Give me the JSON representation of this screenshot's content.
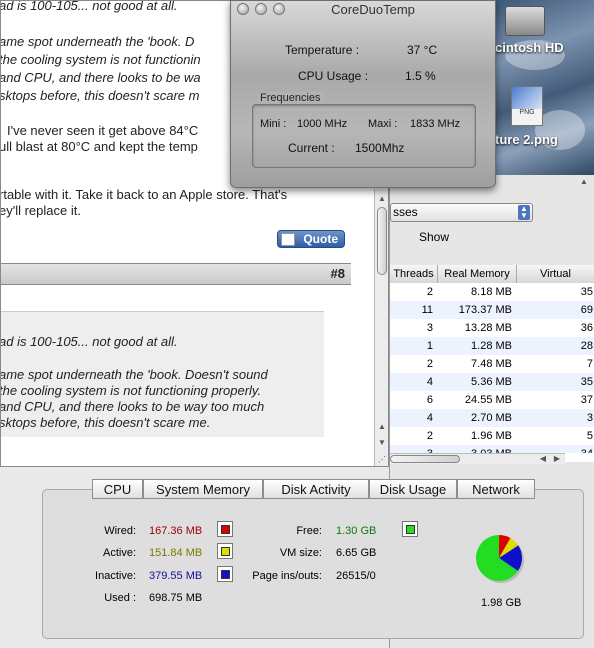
{
  "desktop": {
    "drive_label": "cintosh HD",
    "file_label": "ture 2.png",
    "file_type": "PNG"
  },
  "forum": {
    "post7": {
      "lines": [
        "ad is 100-105... not good at all.",
        "ame spot underneath the 'book. D",
        "the cooling system is not functionin",
        "and CPU, and there looks to be wa",
        "sktops before, this doesn't scare m"
      ],
      "reply_lines": [
        "I've never seen it get above 84°C",
        "ull blast at 80°C and kept the temp",
        "rtable with it. Take it back to an Apple store. That's",
        "ey'll replace it."
      ],
      "quote_label": "Quote"
    },
    "post8": {
      "number": "#8",
      "lines": [
        "ad is 100-105... not good at all.",
        "ame spot underneath the 'book. Doesn't sound",
        "the cooling system is not functioning properly.",
        "and CPU, and there looks to be way too much",
        "sktops before, this doesn't scare me."
      ]
    }
  },
  "coreduo": {
    "title": "CoreDuoTemp",
    "temperature_label": "Temperature :",
    "temperature_value": "37 °C",
    "cpu_label": "CPU Usage :",
    "cpu_value": "1.5  %",
    "freq_title": "Frequencies",
    "mini_label": "Mini :",
    "mini_value": "1000 MHz",
    "maxi_label": "Maxi :",
    "maxi_value": "1833 MHz",
    "current_label": "Current :",
    "current_value": "1500Mhz"
  },
  "activity": {
    "filter_value": "sses",
    "show_label": "Show",
    "columns": [
      "Threads",
      "Real Memory",
      "Virtual"
    ],
    "rows": [
      [
        "2",
        "8.18 MB",
        "35"
      ],
      [
        "11",
        "173.37 MB",
        "69"
      ],
      [
        "3",
        "13.28 MB",
        "36"
      ],
      [
        "1",
        "1.28 MB",
        "28"
      ],
      [
        "2",
        "7.48 MB",
        "7"
      ],
      [
        "4",
        "5.36 MB",
        "35"
      ],
      [
        "6",
        "24.55 MB",
        "37"
      ],
      [
        "4",
        "2.70 MB",
        "3"
      ],
      [
        "2",
        "1.96 MB",
        "5"
      ],
      [
        "3",
        "3.03 MB",
        "34"
      ]
    ],
    "tabs": [
      "CPU",
      "System Memory",
      "Disk Activity",
      "Disk Usage",
      "Network"
    ],
    "memory": {
      "wired_label": "Wired:",
      "wired_value": "167.36 MB",
      "active_label": "Active:",
      "active_value": "151.84 MB",
      "inactive_label": "Inactive:",
      "inactive_value": "379.55 MB",
      "used_label": "Used :",
      "used_value": "698.75 MB",
      "free_label": "Free:",
      "free_value": "1.30 GB",
      "vm_label": "VM size:",
      "vm_value": "6.65 GB",
      "pageins_label": "Page ins/outs:",
      "pageins_value": "26515/0",
      "total": "1.98 GB"
    },
    "colors": {
      "wired": "#dd0000",
      "active": "#dddd00",
      "inactive": "#1010cc",
      "free": "#22dd22"
    },
    "pie_fractions": {
      "wired": 0.083,
      "active": 0.075,
      "inactive": 0.188,
      "free": 0.655
    }
  }
}
